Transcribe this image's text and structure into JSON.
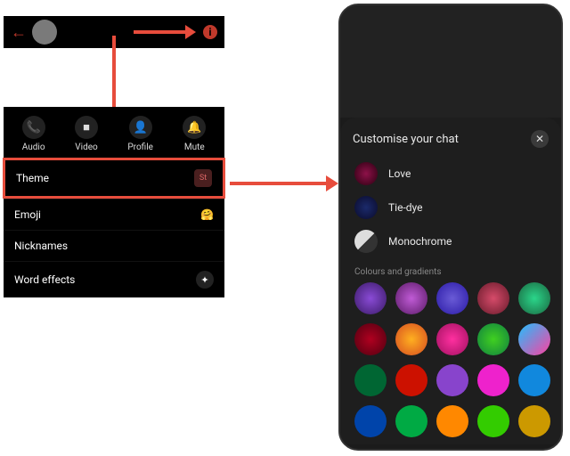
{
  "left": {
    "actions": [
      {
        "label": "Audio",
        "icon": "📞"
      },
      {
        "label": "Video",
        "icon": "■"
      },
      {
        "label": "Profile",
        "icon": "👤"
      },
      {
        "label": "Mute",
        "icon": "🔔"
      }
    ],
    "opts": {
      "theme": {
        "label": "Theme",
        "badge": "St"
      },
      "emoji": {
        "label": "Emoji",
        "icon": "🤗"
      },
      "nick": {
        "label": "Nicknames"
      },
      "wordfx": {
        "label": "Word effects",
        "icon": "✦"
      }
    }
  },
  "right": {
    "title": "Customise your chat",
    "themes": [
      {
        "label": "Love",
        "bg": "radial-gradient(circle,#8e1149,#2a0010)"
      },
      {
        "label": "Tie-dye",
        "bg": "radial-gradient(circle,#1b2a6b,#0a0a2a)"
      },
      {
        "label": "Monochrome",
        "bg": "linear-gradient(135deg,#ddd 50%,#333 50%)"
      }
    ],
    "section": "Colours and gradients",
    "colors": [
      "radial-gradient(circle,#8a4bd6,#3a1a66)",
      "radial-gradient(circle,#c05bd6,#5a1a66)",
      "radial-gradient(circle,#6a5bd6,#2a1aa6)",
      "radial-gradient(circle,#d64b6a,#661a2a)",
      "radial-gradient(circle,#2bd68a,#1a6640)",
      "radial-gradient(circle,#b00020,#500010)",
      "radial-gradient(circle,#ffb020,#d64b20)",
      "radial-gradient(circle,#ff30a0,#a01060)",
      "radial-gradient(circle,#40d020,#108040)",
      "linear-gradient(135deg,#20c0ff,#ff40a0)",
      "#006633",
      "#cc1100",
      "#8844cc",
      "#ee22cc",
      "#1188dd",
      "#0044aa",
      "#00aa44",
      "#ff8800",
      "#33cc00",
      "#cc9900"
    ]
  }
}
